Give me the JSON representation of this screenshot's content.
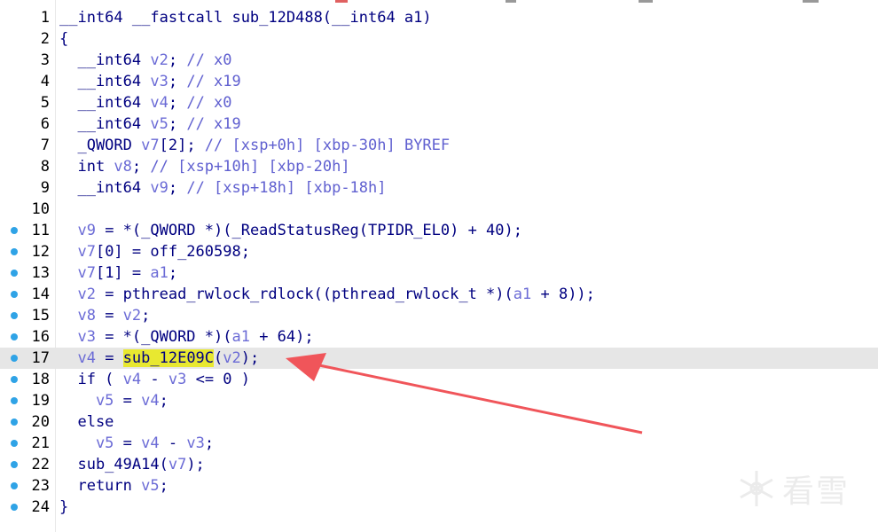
{
  "editor": {
    "lines": [
      {
        "n": "1",
        "dot": false,
        "cur": false,
        "tokens": [
          {
            "t": "__int64 __fastcall sub_12D488(__int64 a1)",
            "c": "kw"
          }
        ]
      },
      {
        "n": "2",
        "dot": false,
        "cur": false,
        "tokens": [
          {
            "t": "{",
            "c": "sym"
          }
        ]
      },
      {
        "n": "3",
        "dot": false,
        "cur": false,
        "tokens": [
          {
            "t": "  __int64 ",
            "c": "kw"
          },
          {
            "t": "v2",
            "c": "var"
          },
          {
            "t": "; ",
            "c": "sym"
          },
          {
            "t": "// x0",
            "c": "com"
          }
        ]
      },
      {
        "n": "4",
        "dot": false,
        "cur": false,
        "tokens": [
          {
            "t": "  __int64 ",
            "c": "kw"
          },
          {
            "t": "v3",
            "c": "var"
          },
          {
            "t": "; ",
            "c": "sym"
          },
          {
            "t": "// x19",
            "c": "com"
          }
        ]
      },
      {
        "n": "5",
        "dot": false,
        "cur": false,
        "tokens": [
          {
            "t": "  __int64 ",
            "c": "kw"
          },
          {
            "t": "v4",
            "c": "var"
          },
          {
            "t": "; ",
            "c": "sym"
          },
          {
            "t": "// x0",
            "c": "com"
          }
        ]
      },
      {
        "n": "6",
        "dot": false,
        "cur": false,
        "tokens": [
          {
            "t": "  __int64 ",
            "c": "kw"
          },
          {
            "t": "v5",
            "c": "var"
          },
          {
            "t": "; ",
            "c": "sym"
          },
          {
            "t": "// x19",
            "c": "com"
          }
        ]
      },
      {
        "n": "7",
        "dot": false,
        "cur": false,
        "tokens": [
          {
            "t": "  _QWORD ",
            "c": "kw"
          },
          {
            "t": "v7",
            "c": "var"
          },
          {
            "t": "[2]; ",
            "c": "sym"
          },
          {
            "t": "// [xsp+0h] [xbp-30h] BYREF",
            "c": "com"
          }
        ]
      },
      {
        "n": "8",
        "dot": false,
        "cur": false,
        "tokens": [
          {
            "t": "  int ",
            "c": "kw"
          },
          {
            "t": "v8",
            "c": "var"
          },
          {
            "t": "; ",
            "c": "sym"
          },
          {
            "t": "// [xsp+10h] [xbp-20h]",
            "c": "com"
          }
        ]
      },
      {
        "n": "9",
        "dot": false,
        "cur": false,
        "tokens": [
          {
            "t": "  __int64 ",
            "c": "kw"
          },
          {
            "t": "v9",
            "c": "var"
          },
          {
            "t": "; ",
            "c": "sym"
          },
          {
            "t": "// [xsp+18h] [xbp-18h]",
            "c": "com"
          }
        ]
      },
      {
        "n": "10",
        "dot": false,
        "cur": false,
        "tokens": []
      },
      {
        "n": "11",
        "dot": true,
        "cur": false,
        "tokens": [
          {
            "t": "  v9",
            "c": "var"
          },
          {
            "t": " = *(_QWORD *)(_ReadStatusReg(TPIDR_EL0) + 40);",
            "c": "sym"
          }
        ]
      },
      {
        "n": "12",
        "dot": true,
        "cur": false,
        "tokens": [
          {
            "t": "  v7",
            "c": "var"
          },
          {
            "t": "[0] = off_260598;",
            "c": "sym"
          }
        ]
      },
      {
        "n": "13",
        "dot": true,
        "cur": false,
        "tokens": [
          {
            "t": "  v7",
            "c": "var"
          },
          {
            "t": "[1] = ",
            "c": "sym"
          },
          {
            "t": "a1",
            "c": "var"
          },
          {
            "t": ";",
            "c": "sym"
          }
        ]
      },
      {
        "n": "14",
        "dot": true,
        "cur": false,
        "tokens": [
          {
            "t": "  v2",
            "c": "var"
          },
          {
            "t": " = pthread_rwlock_rdlock((pthread_rwlock_t *)(",
            "c": "sym"
          },
          {
            "t": "a1",
            "c": "var"
          },
          {
            "t": " + 8));",
            "c": "sym"
          }
        ]
      },
      {
        "n": "15",
        "dot": true,
        "cur": false,
        "tokens": [
          {
            "t": "  v8",
            "c": "var"
          },
          {
            "t": " = ",
            "c": "sym"
          },
          {
            "t": "v2",
            "c": "var"
          },
          {
            "t": ";",
            "c": "sym"
          }
        ]
      },
      {
        "n": "16",
        "dot": true,
        "cur": false,
        "tokens": [
          {
            "t": "  v3",
            "c": "var"
          },
          {
            "t": " = *(_QWORD *)(",
            "c": "sym"
          },
          {
            "t": "a1",
            "c": "var"
          },
          {
            "t": " + 64);",
            "c": "sym"
          }
        ]
      },
      {
        "n": "17",
        "dot": true,
        "cur": true,
        "tokens": [
          {
            "t": "  v4",
            "c": "var"
          },
          {
            "t": " = ",
            "c": "sym"
          },
          {
            "t": "sub_12E09C",
            "c": "hl"
          },
          {
            "t": "(",
            "c": "sym"
          },
          {
            "t": "v2",
            "c": "var"
          },
          {
            "t": ");",
            "c": "sym"
          }
        ]
      },
      {
        "n": "18",
        "dot": true,
        "cur": false,
        "tokens": [
          {
            "t": "  if ( ",
            "c": "kw"
          },
          {
            "t": "v4",
            "c": "var"
          },
          {
            "t": " - ",
            "c": "sym"
          },
          {
            "t": "v3",
            "c": "var"
          },
          {
            "t": " <= 0 )",
            "c": "sym"
          }
        ]
      },
      {
        "n": "19",
        "dot": true,
        "cur": false,
        "tokens": [
          {
            "t": "    v5",
            "c": "var"
          },
          {
            "t": " = ",
            "c": "sym"
          },
          {
            "t": "v4",
            "c": "var"
          },
          {
            "t": ";",
            "c": "sym"
          }
        ]
      },
      {
        "n": "20",
        "dot": true,
        "cur": false,
        "tokens": [
          {
            "t": "  else",
            "c": "kw"
          }
        ]
      },
      {
        "n": "21",
        "dot": true,
        "cur": false,
        "tokens": [
          {
            "t": "    v5",
            "c": "var"
          },
          {
            "t": " = ",
            "c": "sym"
          },
          {
            "t": "v4",
            "c": "var"
          },
          {
            "t": " - ",
            "c": "sym"
          },
          {
            "t": "v3",
            "c": "var"
          },
          {
            "t": ";",
            "c": "sym"
          }
        ]
      },
      {
        "n": "22",
        "dot": true,
        "cur": false,
        "tokens": [
          {
            "t": "  sub_49A14(",
            "c": "sym"
          },
          {
            "t": "v7",
            "c": "var"
          },
          {
            "t": ");",
            "c": "sym"
          }
        ]
      },
      {
        "n": "23",
        "dot": true,
        "cur": false,
        "tokens": [
          {
            "t": "  return ",
            "c": "kw"
          },
          {
            "t": "v5",
            "c": "var"
          },
          {
            "t": ";",
            "c": "sym"
          }
        ]
      },
      {
        "n": "24",
        "dot": true,
        "cur": false,
        "tokens": [
          {
            "t": "}",
            "c": "sym"
          }
        ]
      }
    ]
  },
  "watermark": {
    "text": "看雪",
    "icon": "snowflake-icon"
  },
  "annotation": {
    "icon": "red-arrow-icon",
    "color": "#f0555a"
  },
  "colors": {
    "dot": "#2fa3e6",
    "highlight": "#e8e830",
    "current_line": "#e6e6e6"
  }
}
